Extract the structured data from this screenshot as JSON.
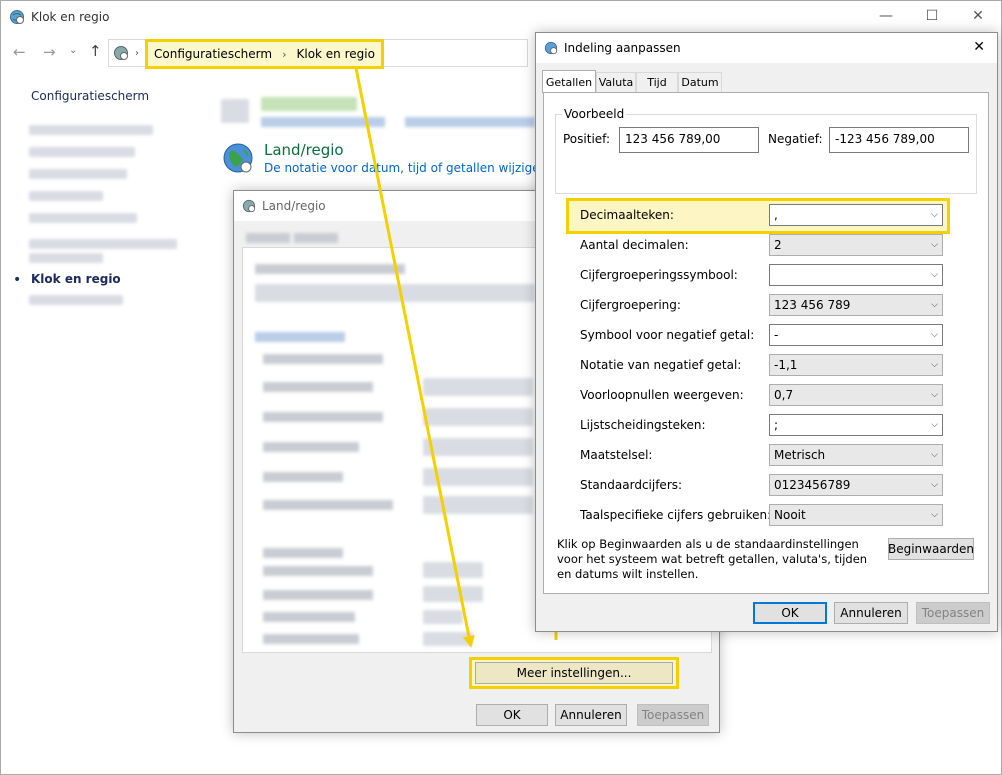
{
  "main_window": {
    "title": "Klok en regio",
    "breadcrumb": [
      "Configuratiescherm",
      "Klok en regio"
    ],
    "sidebar": {
      "home": "Configuratiescherm",
      "active": "Klok en regio"
    },
    "section": {
      "title": "Land/regio",
      "link": "De notatie voor datum, tijd of getallen wijzigen"
    }
  },
  "land_regio_dialog": {
    "title": "Land/regio",
    "more_settings": "Meer instellingen...",
    "buttons": {
      "ok": "OK",
      "cancel": "Annuleren",
      "apply": "Toepassen"
    }
  },
  "format_dialog": {
    "title": "Indeling aanpassen",
    "tabs": [
      "Getallen",
      "Valuta",
      "Tijd",
      "Datum"
    ],
    "example": {
      "legend": "Voorbeeld",
      "positive_label": "Positief:",
      "positive_value": "123 456 789,00",
      "negative_label": "Negatief:",
      "negative_value": "-123 456 789,00"
    },
    "settings": [
      {
        "label": "Decimaalteken:",
        "value": ","
      },
      {
        "label": "Aantal decimalen:",
        "value": "2"
      },
      {
        "label": "Cijfergroeperingssymbool:",
        "value": ""
      },
      {
        "label": "Cijfergroepering:",
        "value": "123 456 789"
      },
      {
        "label": "Symbool voor negatief getal:",
        "value": "-"
      },
      {
        "label": "Notatie van negatief getal:",
        "value": "-1,1"
      },
      {
        "label": "Voorloopnullen weergeven:",
        "value": "0,7"
      },
      {
        "label": "Lijstscheidingsteken:",
        "value": ";"
      },
      {
        "label": "Maatstelsel:",
        "value": "Metrisch"
      },
      {
        "label": "Standaardcijfers:",
        "value": "0123456789"
      },
      {
        "label": "Taalspecifieke cijfers gebruiken:",
        "value": "Nooit"
      }
    ],
    "reset_text": "Klik op Beginwaarden als u de standaardinstellingen voor het systeem wat betreft getallen, valuta's, tijden en datums wilt instellen.",
    "reset_button": "Beginwaarden",
    "buttons": {
      "ok": "OK",
      "cancel": "Annuleren",
      "apply": "Toepassen"
    }
  },
  "colors": {
    "highlight": "#f5d000",
    "link": "#0066cc",
    "section_title": "#0a6e3c"
  },
  "icons": [
    "globe-clock-icon",
    "back-arrow-icon",
    "forward-arrow-icon",
    "up-arrow-icon",
    "chevron-right-icon",
    "minimize-icon",
    "maximize-icon",
    "close-icon",
    "globe-icon"
  ]
}
